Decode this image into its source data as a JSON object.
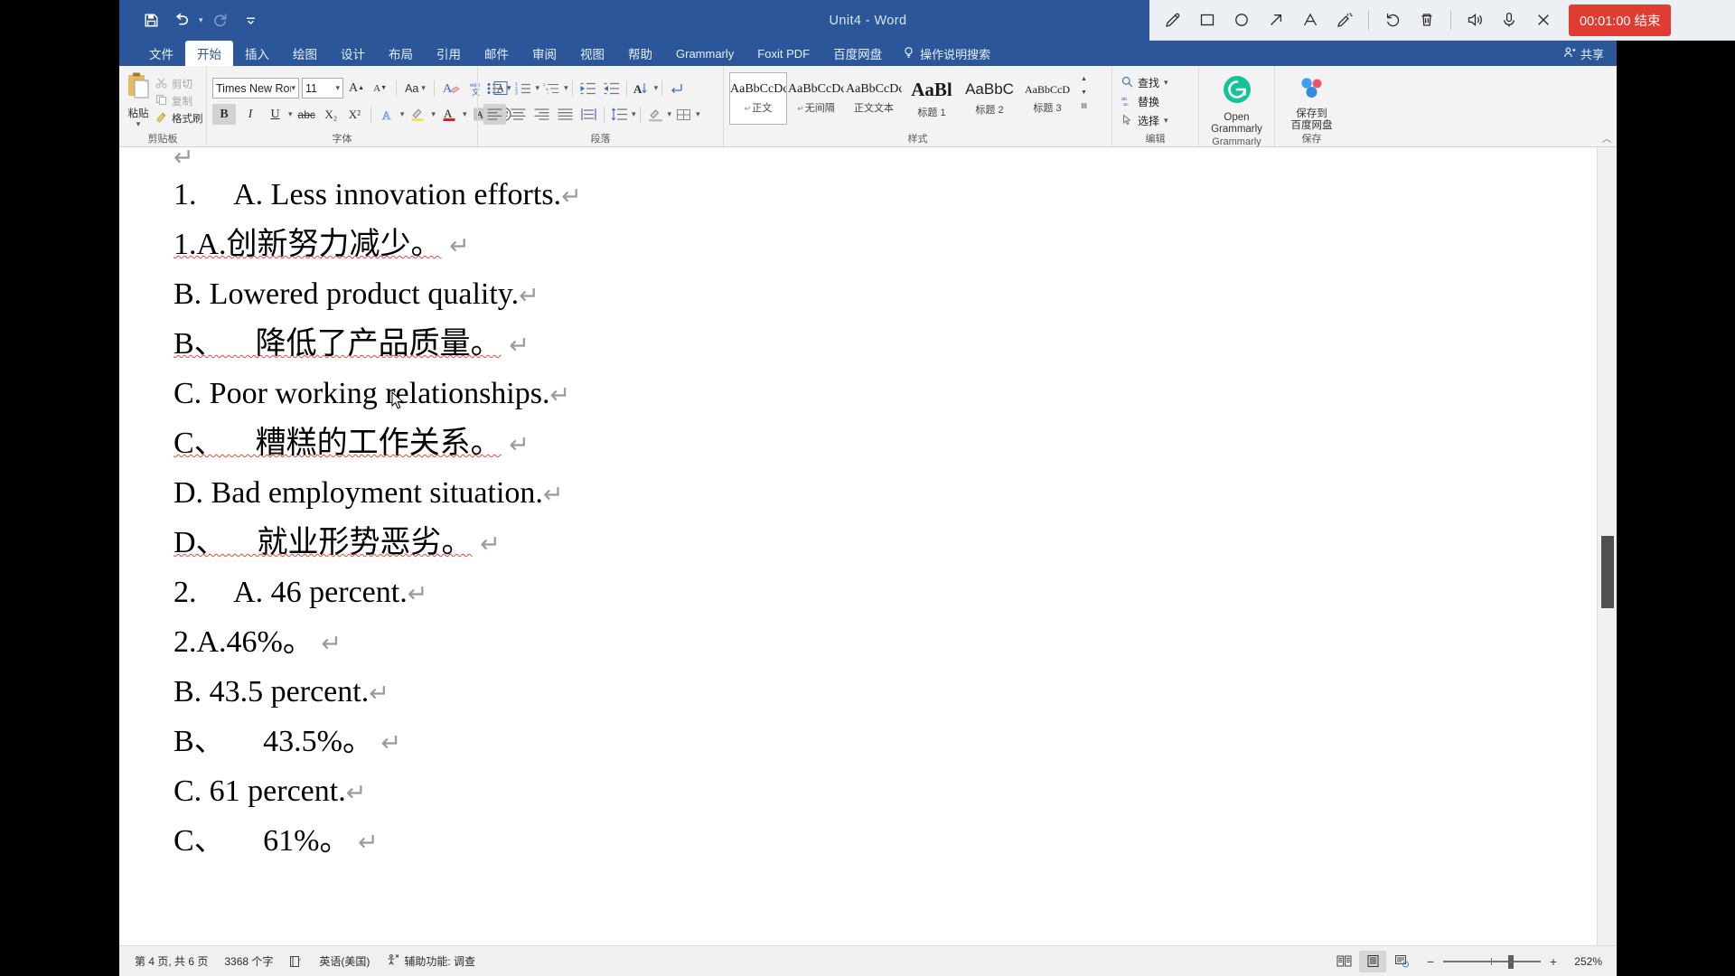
{
  "window": {
    "title": "Unit4  -  Word"
  },
  "quick_access": {
    "save": "save-icon",
    "undo": "undo-icon",
    "redo": "redo-icon",
    "customize": "customize-qat-icon"
  },
  "recorder": {
    "tools": [
      {
        "name": "pen-icon",
        "label": "pen"
      },
      {
        "name": "rectangle-icon",
        "label": "rectangle"
      },
      {
        "name": "ellipse-icon",
        "label": "ellipse"
      },
      {
        "name": "arrow-icon",
        "label": "arrow"
      },
      {
        "name": "text-icon",
        "label": "text"
      },
      {
        "name": "highlighter-icon",
        "label": "highlighter"
      },
      {
        "name": "undo-icon",
        "label": "undo"
      },
      {
        "name": "delete-icon",
        "label": "delete"
      },
      {
        "name": "speaker-icon",
        "label": "speaker"
      },
      {
        "name": "microphone-icon",
        "label": "microphone"
      },
      {
        "name": "close-icon",
        "label": "close"
      }
    ],
    "timer_label": "00:01:00 结束"
  },
  "tabs": [
    {
      "label": "文件",
      "active": false
    },
    {
      "label": "开始",
      "active": true
    },
    {
      "label": "插入",
      "active": false
    },
    {
      "label": "绘图",
      "active": false
    },
    {
      "label": "设计",
      "active": false
    },
    {
      "label": "布局",
      "active": false
    },
    {
      "label": "引用",
      "active": false
    },
    {
      "label": "邮件",
      "active": false
    },
    {
      "label": "审阅",
      "active": false
    },
    {
      "label": "视图",
      "active": false
    },
    {
      "label": "帮助",
      "active": false
    },
    {
      "label": "Grammarly",
      "active": false
    },
    {
      "label": "Foxit PDF",
      "active": false
    },
    {
      "label": "百度网盘",
      "active": false
    }
  ],
  "tell_me": "操作说明搜索",
  "share": "共享",
  "ribbon": {
    "clipboard": {
      "group_label": "剪贴板",
      "paste": "粘贴",
      "cut": "剪切",
      "copy": "复制",
      "format_painter": "格式刷"
    },
    "font": {
      "group_label": "字体",
      "font_name": "Times New Ron",
      "font_size": "11",
      "grow": "A",
      "shrink": "A",
      "change_case": "Aa",
      "clear_format": "clear-formatting-icon",
      "phonetic": "phonetic-guide-icon",
      "char_border": "character-border-icon",
      "bold": "B",
      "italic": "I",
      "underline": "U",
      "strikethrough": "abc",
      "subscript": "X₂",
      "superscript": "X²",
      "text_effects": "text-effects-icon",
      "highlight": "highlight-icon",
      "font_color": "font-color-icon",
      "shading": "character-shading-icon",
      "enclose": "enclose-characters-icon"
    },
    "paragraph": {
      "group_label": "段落",
      "bullets": "bullet-list-icon",
      "numbering": "numbered-list-icon",
      "multilevel": "multilevel-list-icon",
      "decrease_indent": "decrease-indent-icon",
      "increase_indent": "increase-indent-icon",
      "sort": "sort-icon",
      "show_marks": "show-formatting-marks-icon",
      "align_left": "align-left-icon",
      "align_center": "align-center-icon",
      "align_right": "align-right-icon",
      "justify": "justify-icon",
      "distribute": "distribute-icon",
      "line_spacing": "line-spacing-icon",
      "shading_fill": "paragraph-shading-icon",
      "borders": "borders-icon"
    },
    "styles": {
      "group_label": "样式",
      "items": [
        {
          "preview": "AaBbCcDc",
          "name": "正文",
          "pilcrow": "↵",
          "selected": true
        },
        {
          "preview": "AaBbCcDc",
          "name": "无间隔",
          "pilcrow": "↵",
          "selected": false
        },
        {
          "preview": "AaBbCcDc",
          "name": "正文文本",
          "pilcrow": "",
          "selected": false
        },
        {
          "preview": "AaBl",
          "name": "标题 1",
          "pilcrow": "",
          "selected": false
        },
        {
          "preview": "AaBbC",
          "name": "标题 2",
          "pilcrow": "",
          "selected": false
        },
        {
          "preview": "AaBbCcD",
          "name": "标题 3",
          "pilcrow": "",
          "selected": false
        }
      ]
    },
    "editing": {
      "group_label": "编辑",
      "find": "查找",
      "replace": "替换",
      "select": "选择"
    },
    "grammarly": {
      "group_label": "Grammarly",
      "button_line1": "Open",
      "button_line2": "Grammarly"
    },
    "baidu": {
      "group_label": "保存",
      "button_line1": "保存到",
      "button_line2": "百度网盘"
    }
  },
  "document": {
    "top_mark": "↵",
    "lines": [
      {
        "text": "1.  A. Less innovation efforts.",
        "mark": "↵",
        "squiggle": false
      },
      {
        "text": "1.A.创新努力减少。",
        "mark": "↵",
        "squiggle": true,
        "squiggle_from": 4
      },
      {
        "text": "B. Lowered product quality.",
        "mark": "↵",
        "squiggle": false
      },
      {
        "text": "B、 降低了产品质量。",
        "mark": "↵",
        "squiggle": true,
        "squiggle_from": 3
      },
      {
        "text": "C. Poor working relationships.",
        "mark": "↵",
        "squiggle": false
      },
      {
        "text": "C、 糟糕的工作关系。",
        "mark": "↵",
        "squiggle": true,
        "squiggle_from": 3
      },
      {
        "text": "D. Bad employment situation.",
        "mark": "↵",
        "squiggle": false
      },
      {
        "text": "D、 就业形势恶劣。",
        "mark": "↵",
        "squiggle": true,
        "squiggle_from": 3
      },
      {
        "text": "2.  A. 46 percent.",
        "mark": "↵",
        "squiggle": false
      },
      {
        "text": "2.A.46%。",
        "mark": "↵",
        "squiggle": false
      },
      {
        "text": "B. 43.5 percent.",
        "mark": "↵",
        "squiggle": false
      },
      {
        "text": "B、  43.5%。",
        "mark": "↵",
        "squiggle": false
      },
      {
        "text": "C. 61 percent.",
        "mark": "↵",
        "squiggle": false
      },
      {
        "text": "C、  61%。",
        "mark": "↵",
        "squiggle": false
      }
    ]
  },
  "status_bar": {
    "page": "第 4 页, 共 6 页",
    "word_count": "3368 个字",
    "proofing_icon": "proofing-errors-icon",
    "language": "英语(美国)",
    "accessibility": "辅助功能: 调查",
    "views": [
      {
        "name": "read-mode",
        "active": false
      },
      {
        "name": "print-layout",
        "active": true
      },
      {
        "name": "web-layout",
        "active": false
      }
    ],
    "zoom_out": "−",
    "zoom_in": "+",
    "zoom_level": "252%"
  }
}
